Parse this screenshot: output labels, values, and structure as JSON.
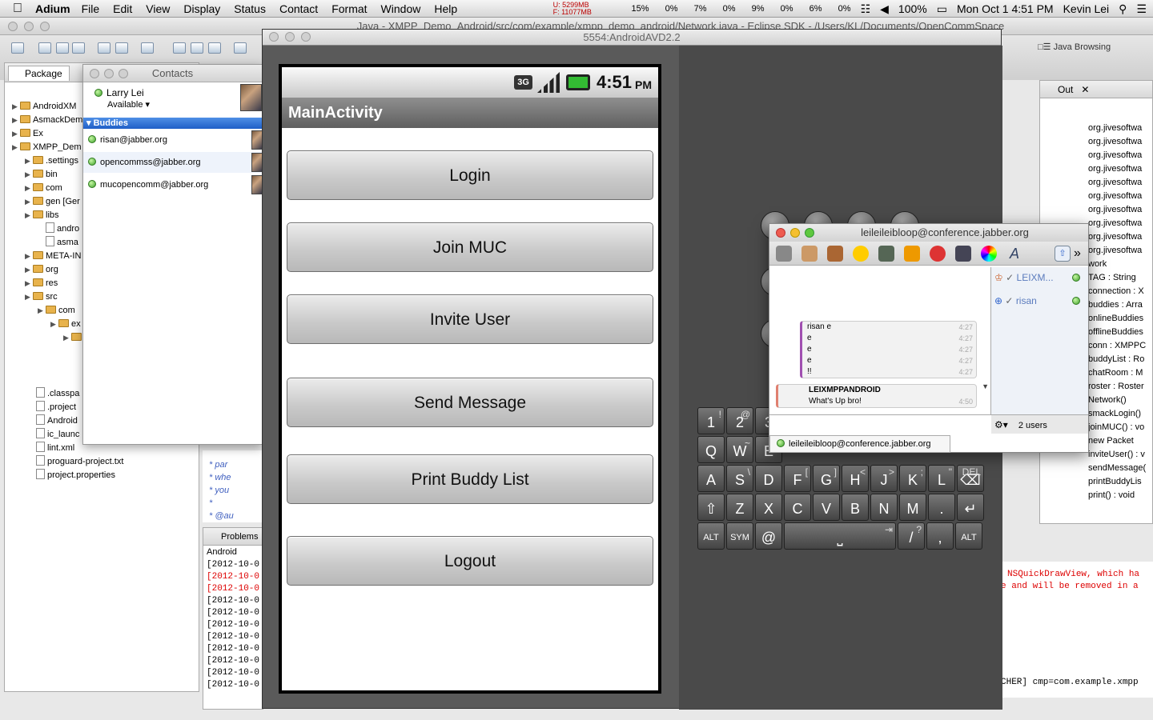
{
  "menubar": {
    "app": "Adium",
    "items": [
      "File",
      "Edit",
      "View",
      "Display",
      "Status",
      "Contact",
      "Format",
      "Window",
      "Help"
    ],
    "mem_u": "U:   5299MB",
    "mem_f": "F: 11077MB",
    "cpu": [
      "15%",
      "0%",
      "7%",
      "0%",
      "9%",
      "0%",
      "6%",
      "0%"
    ],
    "battery": "100%",
    "clock": "Mon Oct 1  4:51 PM",
    "user": "Kevin Lei"
  },
  "eclipse": {
    "title": "Java - XMPP_Demo_Android/src/com/example/xmpp_demo_android/Network.java - Eclipse SDK - /Users/KL/Documents/OpenCommSpace",
    "perspective_label": "Java Browsing",
    "package_tab": "Package",
    "tree": [
      {
        "label": "AndroidXM",
        "kind": "folder",
        "indent": 0
      },
      {
        "label": "AsmackDem",
        "kind": "folder",
        "indent": 0
      },
      {
        "label": "Ex",
        "kind": "folder",
        "indent": 0
      },
      {
        "label": "XMPP_Dem",
        "kind": "folder",
        "indent": 0
      },
      {
        "label": ".settings",
        "kind": "folder",
        "indent": 1
      },
      {
        "label": "bin",
        "kind": "folder",
        "indent": 1
      },
      {
        "label": "com",
        "kind": "folder",
        "indent": 1
      },
      {
        "label": "gen [Ger",
        "kind": "folder",
        "indent": 1
      },
      {
        "label": "libs",
        "kind": "folder",
        "indent": 1
      },
      {
        "label": "andro",
        "kind": "jar",
        "indent": 2
      },
      {
        "label": "asma",
        "kind": "jar",
        "indent": 2
      },
      {
        "label": "META-IN",
        "kind": "folder",
        "indent": 1
      },
      {
        "label": "org",
        "kind": "folder",
        "indent": 1
      },
      {
        "label": "res",
        "kind": "folder",
        "indent": 1
      },
      {
        "label": "src",
        "kind": "folder",
        "indent": 1
      },
      {
        "label": "com",
        "kind": "folder",
        "indent": 2
      },
      {
        "label": "ex",
        "kind": "folder",
        "indent": 3
      },
      {
        "label": "",
        "kind": "folder",
        "indent": 4
      }
    ],
    "tree_files": [
      ".classpa",
      ".project",
      "Android",
      "ic_launc",
      "lint.xml",
      "proguard-project.txt",
      "project.properties"
    ],
    "code_lines": [
      "* par",
      "* whe",
      "* you",
      "*",
      "* @au"
    ],
    "problems_tab": "Problems",
    "console_label": "Android",
    "console_lines": [
      {
        "text": "[2012-10-0",
        "red": false
      },
      {
        "text": "[2012-10-0",
        "red": true
      },
      {
        "text": "[2012-10-0",
        "red": true
      },
      {
        "text": "[2012-10-0",
        "red": false
      },
      {
        "text": "[2012-10-0",
        "red": false
      },
      {
        "text": "[2012-10-0",
        "red": false
      },
      {
        "text": "[2012-10-0",
        "red": false
      },
      {
        "text": "[2012-10-0",
        "red": false
      },
      {
        "text": "[2012-10-0",
        "red": false
      },
      {
        "text": "[2012-10-0",
        "red": false
      },
      {
        "text": "[2012-10-0",
        "red": false
      }
    ],
    "outline_tab": "Out",
    "outline": [
      "org.jivesoftwa",
      "org.jivesoftwa",
      "org.jivesoftwa",
      "org.jivesoftwa",
      "org.jivesoftwa",
      "org.jivesoftwa",
      "org.jivesoftwa",
      "org.jivesoftwa",
      "org.jivesoftwa",
      "org.jivesoftwa",
      "work",
      "TAG : String",
      "connection : X",
      "buddies : Arra",
      "onlineBuddies",
      "offlineBuddies",
      "conn : XMPPC",
      "buddyList : Ro",
      "chatRoom : M",
      "roster : Roster",
      "Network()",
      "smackLogin()",
      "joinMUC() : vo",
      "new Packet",
      "inviteUser() : v",
      "sendMessage(",
      "printBuddyLis",
      "print() : void"
    ],
    "right_console": [
      "NSQuickDrawView, which ha",
      "e and will be removed in a",
      "CHER] cmp=com.example.xmpp"
    ]
  },
  "contacts": {
    "title": "Contacts",
    "user": "Larry Lei",
    "status": "Available",
    "group": "Buddies",
    "buddies": [
      "risan@jabber.org",
      "opencommss@jabber.org",
      "mucopencomm@jabber.org"
    ]
  },
  "emulator": {
    "title": "5554:AndroidAVD2.2",
    "time": "4:51",
    "ampm": "PM",
    "network": "3G",
    "app_title": "MainActivity",
    "buttons": [
      "Login",
      "Join MUC",
      "Invite User",
      "Send Message",
      "Print Buddy List",
      "Logout"
    ]
  },
  "keyboard": {
    "row1": [
      {
        "k": "1",
        "s": "!"
      },
      {
        "k": "2",
        "s": "@"
      },
      {
        "k": "3",
        "s": ""
      }
    ],
    "row2": [
      {
        "k": "Q",
        "s": ""
      },
      {
        "k": "W",
        "s": "~"
      },
      {
        "k": "E",
        "s": ""
      }
    ],
    "row3": [
      {
        "k": "A",
        "s": ""
      },
      {
        "k": "S",
        "s": "\\"
      },
      {
        "k": "D",
        "s": ""
      },
      {
        "k": "F",
        "s": "["
      },
      {
        "k": "G",
        "s": "]"
      },
      {
        "k": "H",
        "s": "<"
      },
      {
        "k": "J",
        "s": ">"
      },
      {
        "k": "K",
        "s": ";"
      },
      {
        "k": "L",
        "s": "\""
      },
      {
        "k": "⌫",
        "s": "DEL"
      }
    ],
    "row4": [
      {
        "k": "⇧",
        "s": ""
      },
      {
        "k": "Z",
        "s": ""
      },
      {
        "k": "X",
        "s": ""
      },
      {
        "k": "C",
        "s": ""
      },
      {
        "k": "V",
        "s": ""
      },
      {
        "k": "B",
        "s": ""
      },
      {
        "k": "N",
        "s": ""
      },
      {
        "k": "M",
        "s": ""
      },
      {
        "k": ".",
        "s": ""
      },
      {
        "k": "↵",
        "s": ""
      }
    ],
    "row5": [
      {
        "k": "ALT",
        "s": ""
      },
      {
        "k": "SYM",
        "s": ""
      },
      {
        "k": "@",
        "s": ""
      },
      {
        "k": "⎵",
        "s": "⇥"
      },
      {
        "k": "/",
        "s": "?"
      },
      {
        "k": ",",
        "s": ""
      },
      {
        "k": "ALT",
        "s": ""
      }
    ]
  },
  "chat": {
    "title": "leileileibloop@conference.jabber.org",
    "msg1": {
      "sender": "risan e",
      "lines": [
        "e",
        "e",
        "e",
        "!!"
      ],
      "times": [
        "4:27",
        "4:27",
        "4:27",
        "4:27",
        "4:27"
      ]
    },
    "msg2": {
      "sender": "LEIXMPPANDROID",
      "text": "What's Up bro!",
      "time": "4:50"
    },
    "users": [
      "LEIXM...",
      "risan"
    ],
    "user_count": "2 users",
    "tab": "leileileibloop@conference.jabber.org"
  }
}
